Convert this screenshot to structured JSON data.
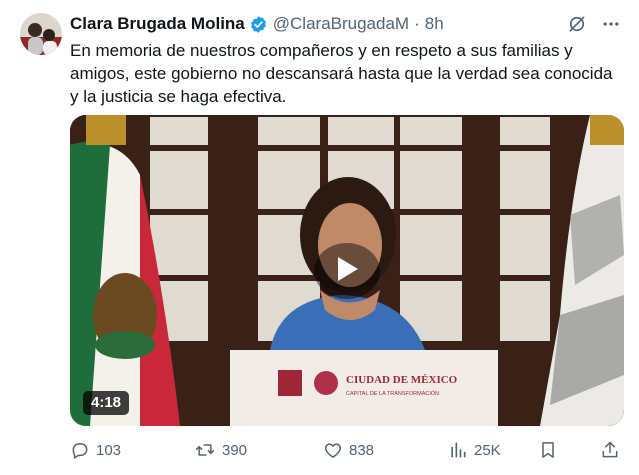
{
  "tweet": {
    "author_name": "Clara Brugada Molina",
    "handle": "@ClaraBrugadaM",
    "separator": "·",
    "time": "8h",
    "text": "En memoria de nuestros compañeros y en respeto a sus familias y amigos, este gobierno no descansará hasta que la verdad sea conocida y la justicia se haga efectiva."
  },
  "media": {
    "duration": "4:18",
    "podium_title": "CIUDAD DE MÉXICO",
    "podium_subtitle": "CAPITAL DE LA TRANSFORMACIÓN"
  },
  "actions": {
    "replies": "103",
    "reposts": "390",
    "likes": "838",
    "views": "25K"
  },
  "icons": [
    "verified-badge-icon",
    "grok-icon",
    "more-icon",
    "play-icon",
    "reply-icon",
    "repost-icon",
    "like-icon",
    "views-icon",
    "share-icon"
  ],
  "colors": {
    "verified": "#1d9bf0",
    "muted": "#536471",
    "text": "#0f1419"
  }
}
